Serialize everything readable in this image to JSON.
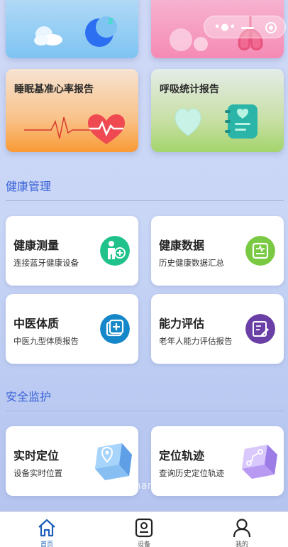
{
  "top_cards": [
    {
      "id": "sleep",
      "icon": "moon-icon"
    },
    {
      "id": "lung",
      "icon": "lung-icon"
    }
  ],
  "report_cards": [
    {
      "title": "睡眠基准心率报告",
      "icon": "heart-rate-icon"
    },
    {
      "title": "呼吸统计报告",
      "icon": "notebook-icon"
    }
  ],
  "mini_program_capsule": {
    "more_icon": "more-dots-icon",
    "minimize_icon": "minimize-icon",
    "close_icon": "target-close-icon"
  },
  "health_section": {
    "title": "健康管理",
    "items": [
      {
        "title": "健康测量",
        "subtitle": "连接蓝牙健康设备",
        "icon": "person-plus-icon",
        "color": "#1fc28b"
      },
      {
        "title": "健康数据",
        "subtitle": "历史健康数据汇总",
        "icon": "data-card-icon",
        "color": "#7ac943"
      },
      {
        "title": "中医体质",
        "subtitle": "中医九型体质报告",
        "icon": "medical-kit-icon",
        "color": "#1687c8"
      },
      {
        "title": "能力评估",
        "subtitle": "老年人能力评估报告",
        "icon": "edit-form-icon",
        "color": "#6a3fa6"
      }
    ]
  },
  "safety_section": {
    "title": "安全监护",
    "items": [
      {
        "title": "实时定位",
        "subtitle": "设备实时位置",
        "icon": "location-cube-icon"
      },
      {
        "title": "定位轨迹",
        "subtitle": "查询历史定位轨迹",
        "icon": "track-cube-icon"
      }
    ]
  },
  "watermark": "https://www.huzhan.com/ishop47020",
  "tabbar": [
    {
      "label": "首页",
      "icon": "home-icon",
      "active": true
    },
    {
      "label": "设备",
      "icon": "device-icon",
      "active": false
    },
    {
      "label": "我的",
      "icon": "user-icon",
      "active": false
    }
  ],
  "colors": {
    "accent": "#3b63d8",
    "tab_active": "#1d5fb8"
  }
}
